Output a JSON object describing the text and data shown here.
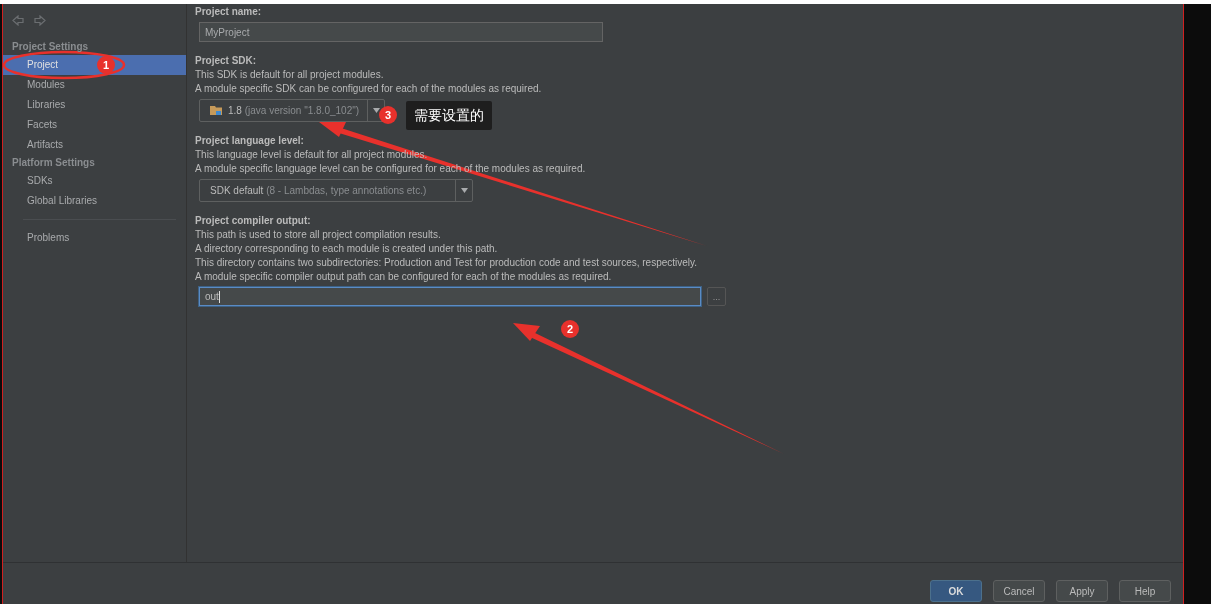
{
  "sidebar": {
    "sections": [
      {
        "title": "Project Settings",
        "items": [
          {
            "label": "Project",
            "selected": true
          },
          {
            "label": "Modules",
            "selected": false
          },
          {
            "label": "Libraries",
            "selected": false
          },
          {
            "label": "Facets",
            "selected": false
          },
          {
            "label": "Artifacts",
            "selected": false
          }
        ]
      },
      {
        "title": "Platform Settings",
        "items": [
          {
            "label": "SDKs",
            "selected": false
          },
          {
            "label": "Global Libraries",
            "selected": false
          }
        ]
      },
      {
        "items": [
          {
            "label": "Problems",
            "selected": false
          }
        ]
      }
    ]
  },
  "settings": [
    {
      "kind": "text",
      "label": "Project name:",
      "value": "MyProject"
    },
    {
      "kind": "sdk",
      "label": "Project SDK:",
      "description": [
        "This SDK is default for all project modules.",
        "A module specific SDK can be configured for each of the modules as required."
      ],
      "value": "1.8",
      "detail": "(java version \"1.8.0_102\")"
    },
    {
      "kind": "combo",
      "label": "Project language level:",
      "description": [
        "This language level is default for all project modules.",
        "A module specific language level can be configured for each of the modules as required."
      ],
      "value": "SDK default",
      "detail": "(8 - Lambdas, type annotations etc.)"
    },
    {
      "kind": "path",
      "label": "Project compiler output:",
      "description": [
        "This path is used to store all project compilation results.",
        "A directory corresponding to each module is created under this path.",
        "This directory contains two subdirectories: Production and Test for production code and test sources, respectively.",
        "A module specific compiler output path can be configured for each of the modules as required."
      ],
      "value": "out",
      "browse": "..."
    }
  ],
  "buttons": [
    {
      "label": "OK",
      "default": true
    },
    {
      "label": "Cancel",
      "default": false
    },
    {
      "label": "Apply",
      "default": false
    },
    {
      "label": "Help",
      "default": false
    }
  ],
  "annotations": {
    "badges": [
      "1",
      "2",
      "3"
    ],
    "callout": "需要设置的"
  }
}
